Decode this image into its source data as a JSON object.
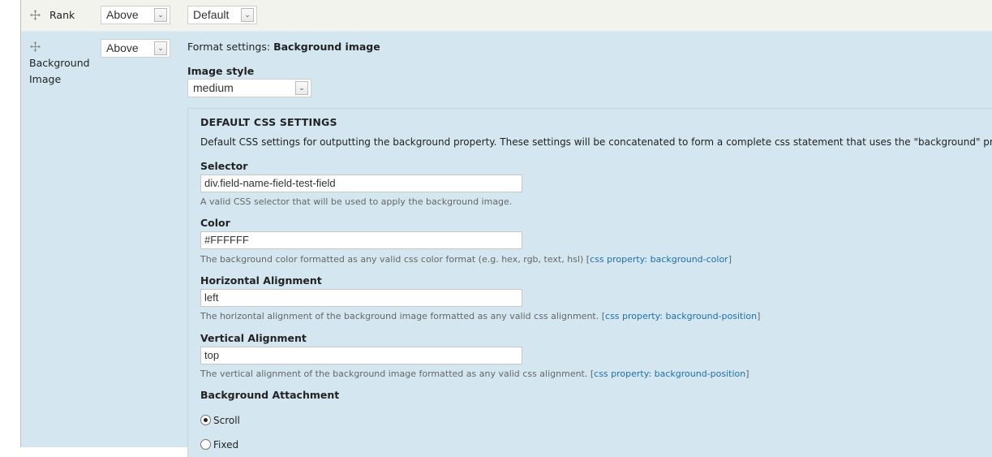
{
  "rows": {
    "rank": {
      "label": "Rank",
      "label_position": "Above",
      "formatter": "Default"
    },
    "background_image": {
      "label": "Background Image",
      "label_position": "Above"
    }
  },
  "format_settings": {
    "prefix": "Format settings:",
    "name": "Background image",
    "image_style_label": "Image style",
    "image_style_value": "medium"
  },
  "css_settings": {
    "legend": "DEFAULT CSS SETTINGS",
    "description": "Default CSS settings for outputting the background property. These settings will be concatenated to form a complete css statement that uses the \"background\" property.",
    "fields": [
      {
        "label": "Selector",
        "value": "div.field-name-field-test-field",
        "description": "A valid CSS selector that will be used to apply the background image.",
        "link": ""
      },
      {
        "label": "Color",
        "value": "#FFFFFF",
        "description": "The background color formatted as any valid css color format (e.g. hex, rgb, text, hsl) [",
        "link": "css property: background-color",
        "suffix": "]"
      },
      {
        "label": "Horizontal Alignment",
        "value": "left",
        "description": "The horizontal alignment of the background image formatted as any valid css alignment. [",
        "link": "css property: background-position",
        "suffix": "]"
      },
      {
        "label": "Vertical Alignment",
        "value": "top",
        "description": "The vertical alignment of the background image formatted as any valid css alignment. [",
        "link": "css property: background-position",
        "suffix": "]"
      }
    ],
    "attachment": {
      "label": "Background Attachment",
      "options": [
        {
          "label": "Scroll",
          "checked": true
        },
        {
          "label": "Fixed",
          "checked": false
        }
      ]
    }
  },
  "icons": {
    "drag": "move-cross-icon",
    "select_arrow": "chevron-down-icon"
  },
  "colors": {
    "row_highlight": "#d4e7f1",
    "row_default": "#f3f3ee",
    "link": "#1f6fa8"
  }
}
